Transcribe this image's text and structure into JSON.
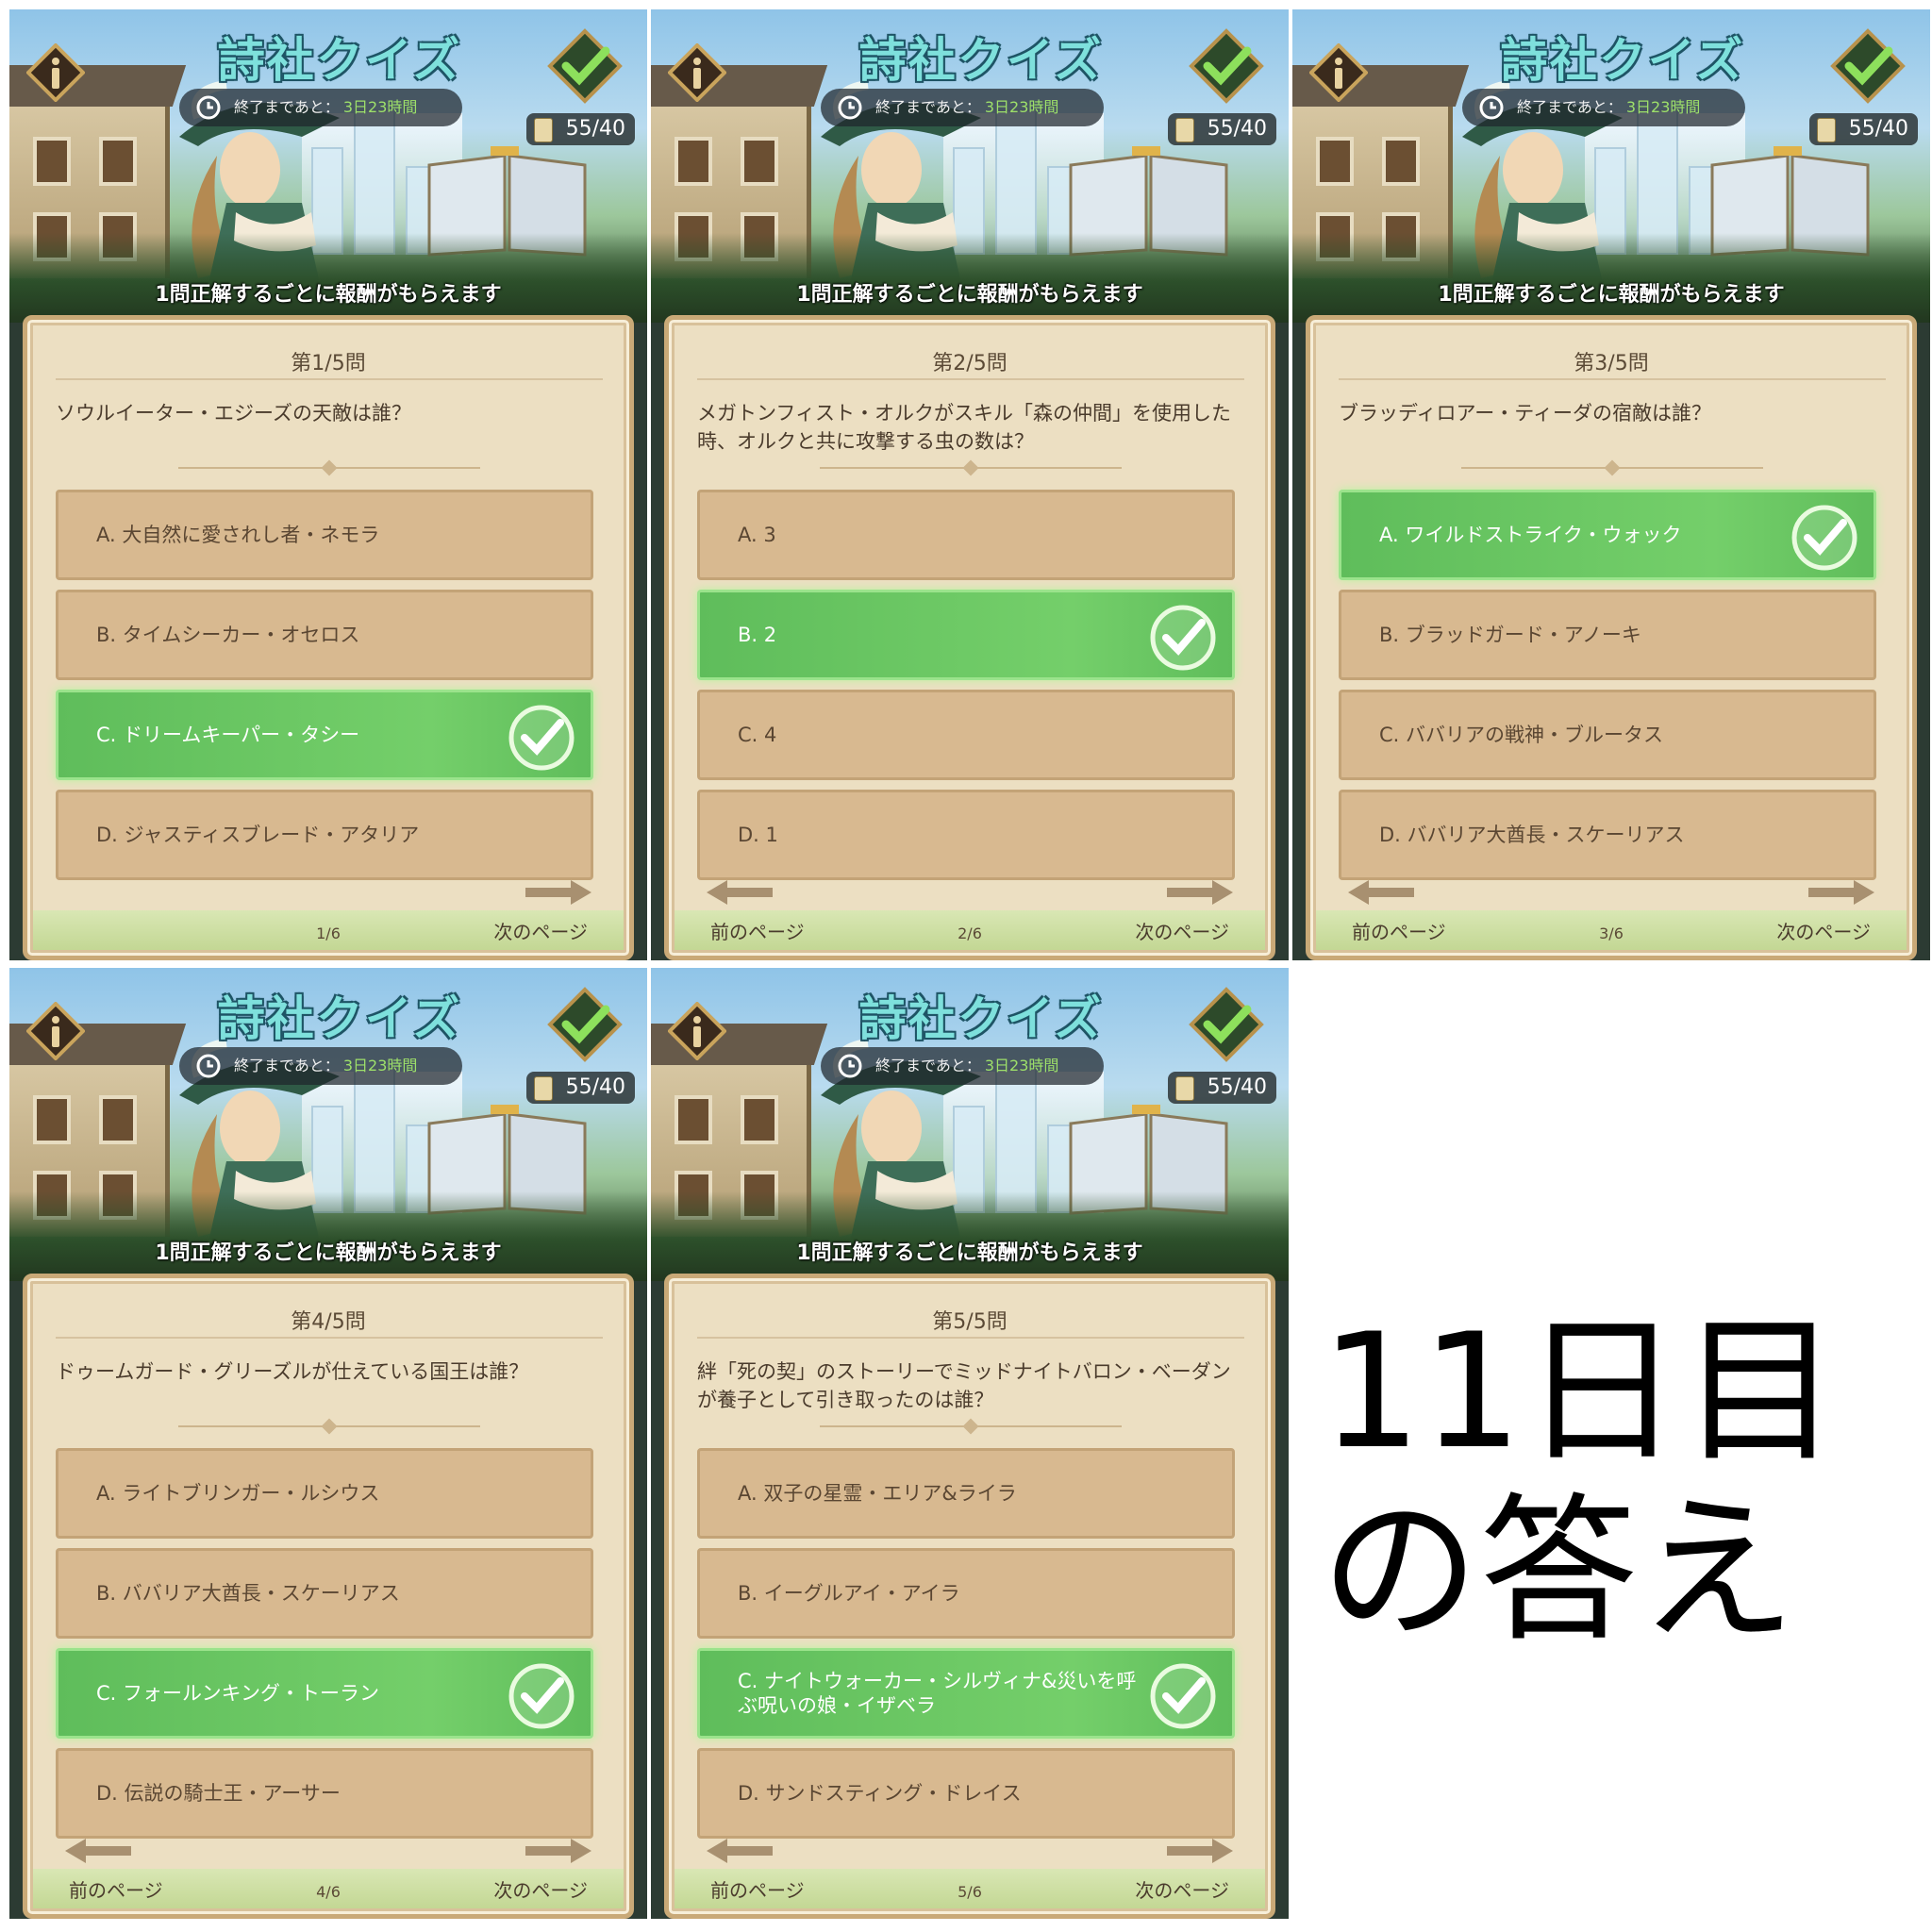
{
  "header": {
    "title": "詩社クイズ",
    "timer_label": "終了まであと：",
    "timer_value": "3日23時間",
    "subtitle": "1問正解するごとに報酬がもらえます",
    "progress": "55/40"
  },
  "nav": {
    "prev": "前のページ",
    "next": "次のページ"
  },
  "panels": [
    {
      "qnum": "第1/5問",
      "question": "ソウルイーター・エジーズの天敵は誰？",
      "options": [
        "A. 大自然に愛されし者・ネモラ",
        "B. タイムシーカー・オセロス",
        "C. ドリームキーパー・タシー",
        "D. ジャスティスブレード・アタリア"
      ],
      "correct": 2,
      "page": "1/6"
    },
    {
      "qnum": "第2/5問",
      "question": "メガトンフィスト・オルクがスキル「森の仲間」を使用した時、オルクと共に攻撃する虫の数は？",
      "options": [
        "A. 3",
        "B. 2",
        "C. 4",
        "D. 1"
      ],
      "correct": 1,
      "page": "2/6"
    },
    {
      "qnum": "第3/5問",
      "question": "ブラッディロアー・ティーダの宿敵は誰？",
      "options": [
        "A. ワイルドストライク・ウォック",
        "B. ブラッドガード・アノーキ",
        "C. ババリアの戦神・ブルータス",
        "D. ババリア大酋長・スケーリアス"
      ],
      "correct": 0,
      "page": "3/6"
    },
    {
      "qnum": "第4/5問",
      "question": "ドゥームガード・グリーズルが仕えている国王は誰？",
      "options": [
        "A. ライトブリンガー・ルシウス",
        "B. ババリア大酋長・スケーリアス",
        "C. フォールンキング・トーラン",
        "D. 伝説の騎士王・アーサー"
      ],
      "correct": 2,
      "page": "4/6"
    },
    {
      "qnum": "第5/5問",
      "question": "絆「死の契」のストーリーでミッドナイトバロン・ベーダンが養子として引き取ったのは誰？",
      "options": [
        "A. 双子の星霊・エリア&ライラ",
        "B. イーグルアイ・アイラ",
        "C. ナイトウォーカー・シルヴィナ&災いを呼ぶ呪いの娘・イザベラ",
        "D. サンドスティング・ドレイス"
      ],
      "correct": 2,
      "page": "5/6"
    }
  ],
  "caption": {
    "line1": "11日目",
    "line2": "の答え"
  }
}
